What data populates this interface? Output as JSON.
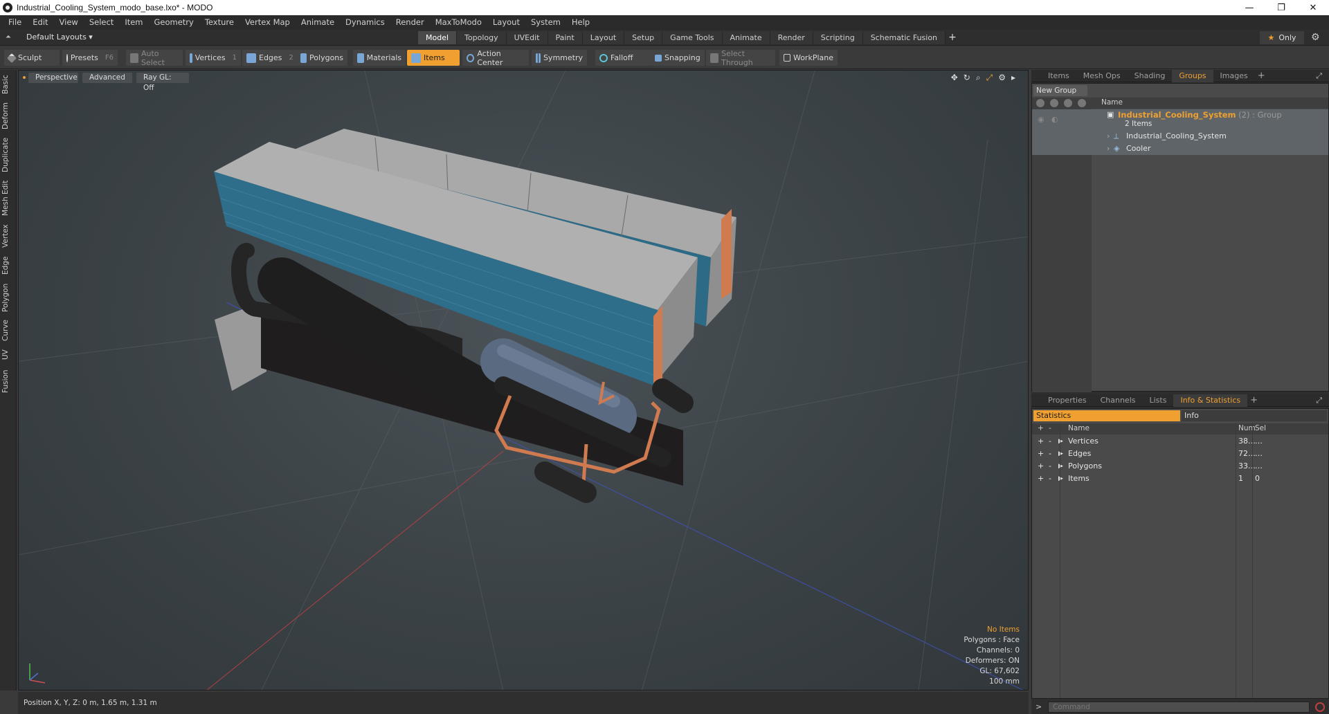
{
  "window": {
    "title": "Industrial_Cooling_System_modo_base.lxo* - MODO",
    "minimize": "—",
    "maximize": "❐",
    "close": "✕"
  },
  "menu": [
    "File",
    "Edit",
    "View",
    "Select",
    "Item",
    "Geometry",
    "Texture",
    "Vertex Map",
    "Animate",
    "Dynamics",
    "Render",
    "MaxToModo",
    "Layout",
    "System",
    "Help"
  ],
  "layout": {
    "selector": "Default Layouts ▾",
    "tabs": [
      "Model",
      "Topology",
      "UVEdit",
      "Paint",
      "Layout",
      "Setup",
      "Game Tools",
      "Animate",
      "Render",
      "Scripting",
      "Schematic Fusion"
    ],
    "active_tab": "Model",
    "add_tab": "+",
    "only_label": "Only"
  },
  "toolbar": {
    "sculpt": "Sculpt",
    "presets": "Presets",
    "presets_key": "F6",
    "auto_select": "Auto Select",
    "vertices": "Vertices",
    "vertices_num": "1",
    "edges": "Edges",
    "edges_num": "2",
    "polygons": "Polygons",
    "materials": "Materials",
    "items": "Items",
    "action_center": "Action Center",
    "symmetry": "Symmetry",
    "falloff": "Falloff",
    "snapping": "Snapping",
    "select_through": "Select Through",
    "workplane": "WorkPlane"
  },
  "left_tabs": [
    "Basic",
    "Deform",
    "Duplicate",
    "Mesh Edit",
    "Vertex",
    "Edge",
    "Polygon",
    "Curve",
    "UV",
    "Fusion"
  ],
  "viewport": {
    "perspective": "Perspective",
    "advanced": "Advanced",
    "raygl": "Ray GL: Off",
    "info": {
      "no_items": "No Items",
      "polygons": "Polygons : Face",
      "channels": "Channels: 0",
      "deformers": "Deformers: ON",
      "gl": "GL: 67,602",
      "scale": "100 mm"
    }
  },
  "status": {
    "position": "Position X, Y, Z:   0 m, 1.65 m, 1.31 m"
  },
  "groups_panel": {
    "tabs": [
      "Items",
      "Mesh Ops",
      "Shading",
      "Groups",
      "Images"
    ],
    "active_tab": "Groups",
    "new_group": "New Group",
    "name_header": "Name",
    "group_name": "Industrial_Cooling_System",
    "group_suffix": " (2) : Group",
    "items_count": "2 Items",
    "children": [
      "Industrial_Cooling_System",
      "Cooler"
    ]
  },
  "info_panel": {
    "tabs": [
      "Properties",
      "Channels",
      "Lists",
      "Info & Statistics"
    ],
    "active_tab": "Info & Statistics",
    "statistics": "Statistics",
    "info": "Info",
    "headers": {
      "name": "Name",
      "num": "Num",
      "sel": "Sel"
    },
    "rows": [
      {
        "name": "Vertices",
        "num": "38…",
        "sel": "…"
      },
      {
        "name": "Edges",
        "num": "72…",
        "sel": "…"
      },
      {
        "name": "Polygons",
        "num": "33…",
        "sel": "…"
      },
      {
        "name": "Items",
        "num": "1",
        "sel": "0"
      }
    ]
  },
  "command": {
    "prompt": ">",
    "placeholder": "Command"
  },
  "colors": {
    "accent": "#f0a030",
    "fin_blue": "#2e6e8a",
    "copper": "#d07a50"
  }
}
